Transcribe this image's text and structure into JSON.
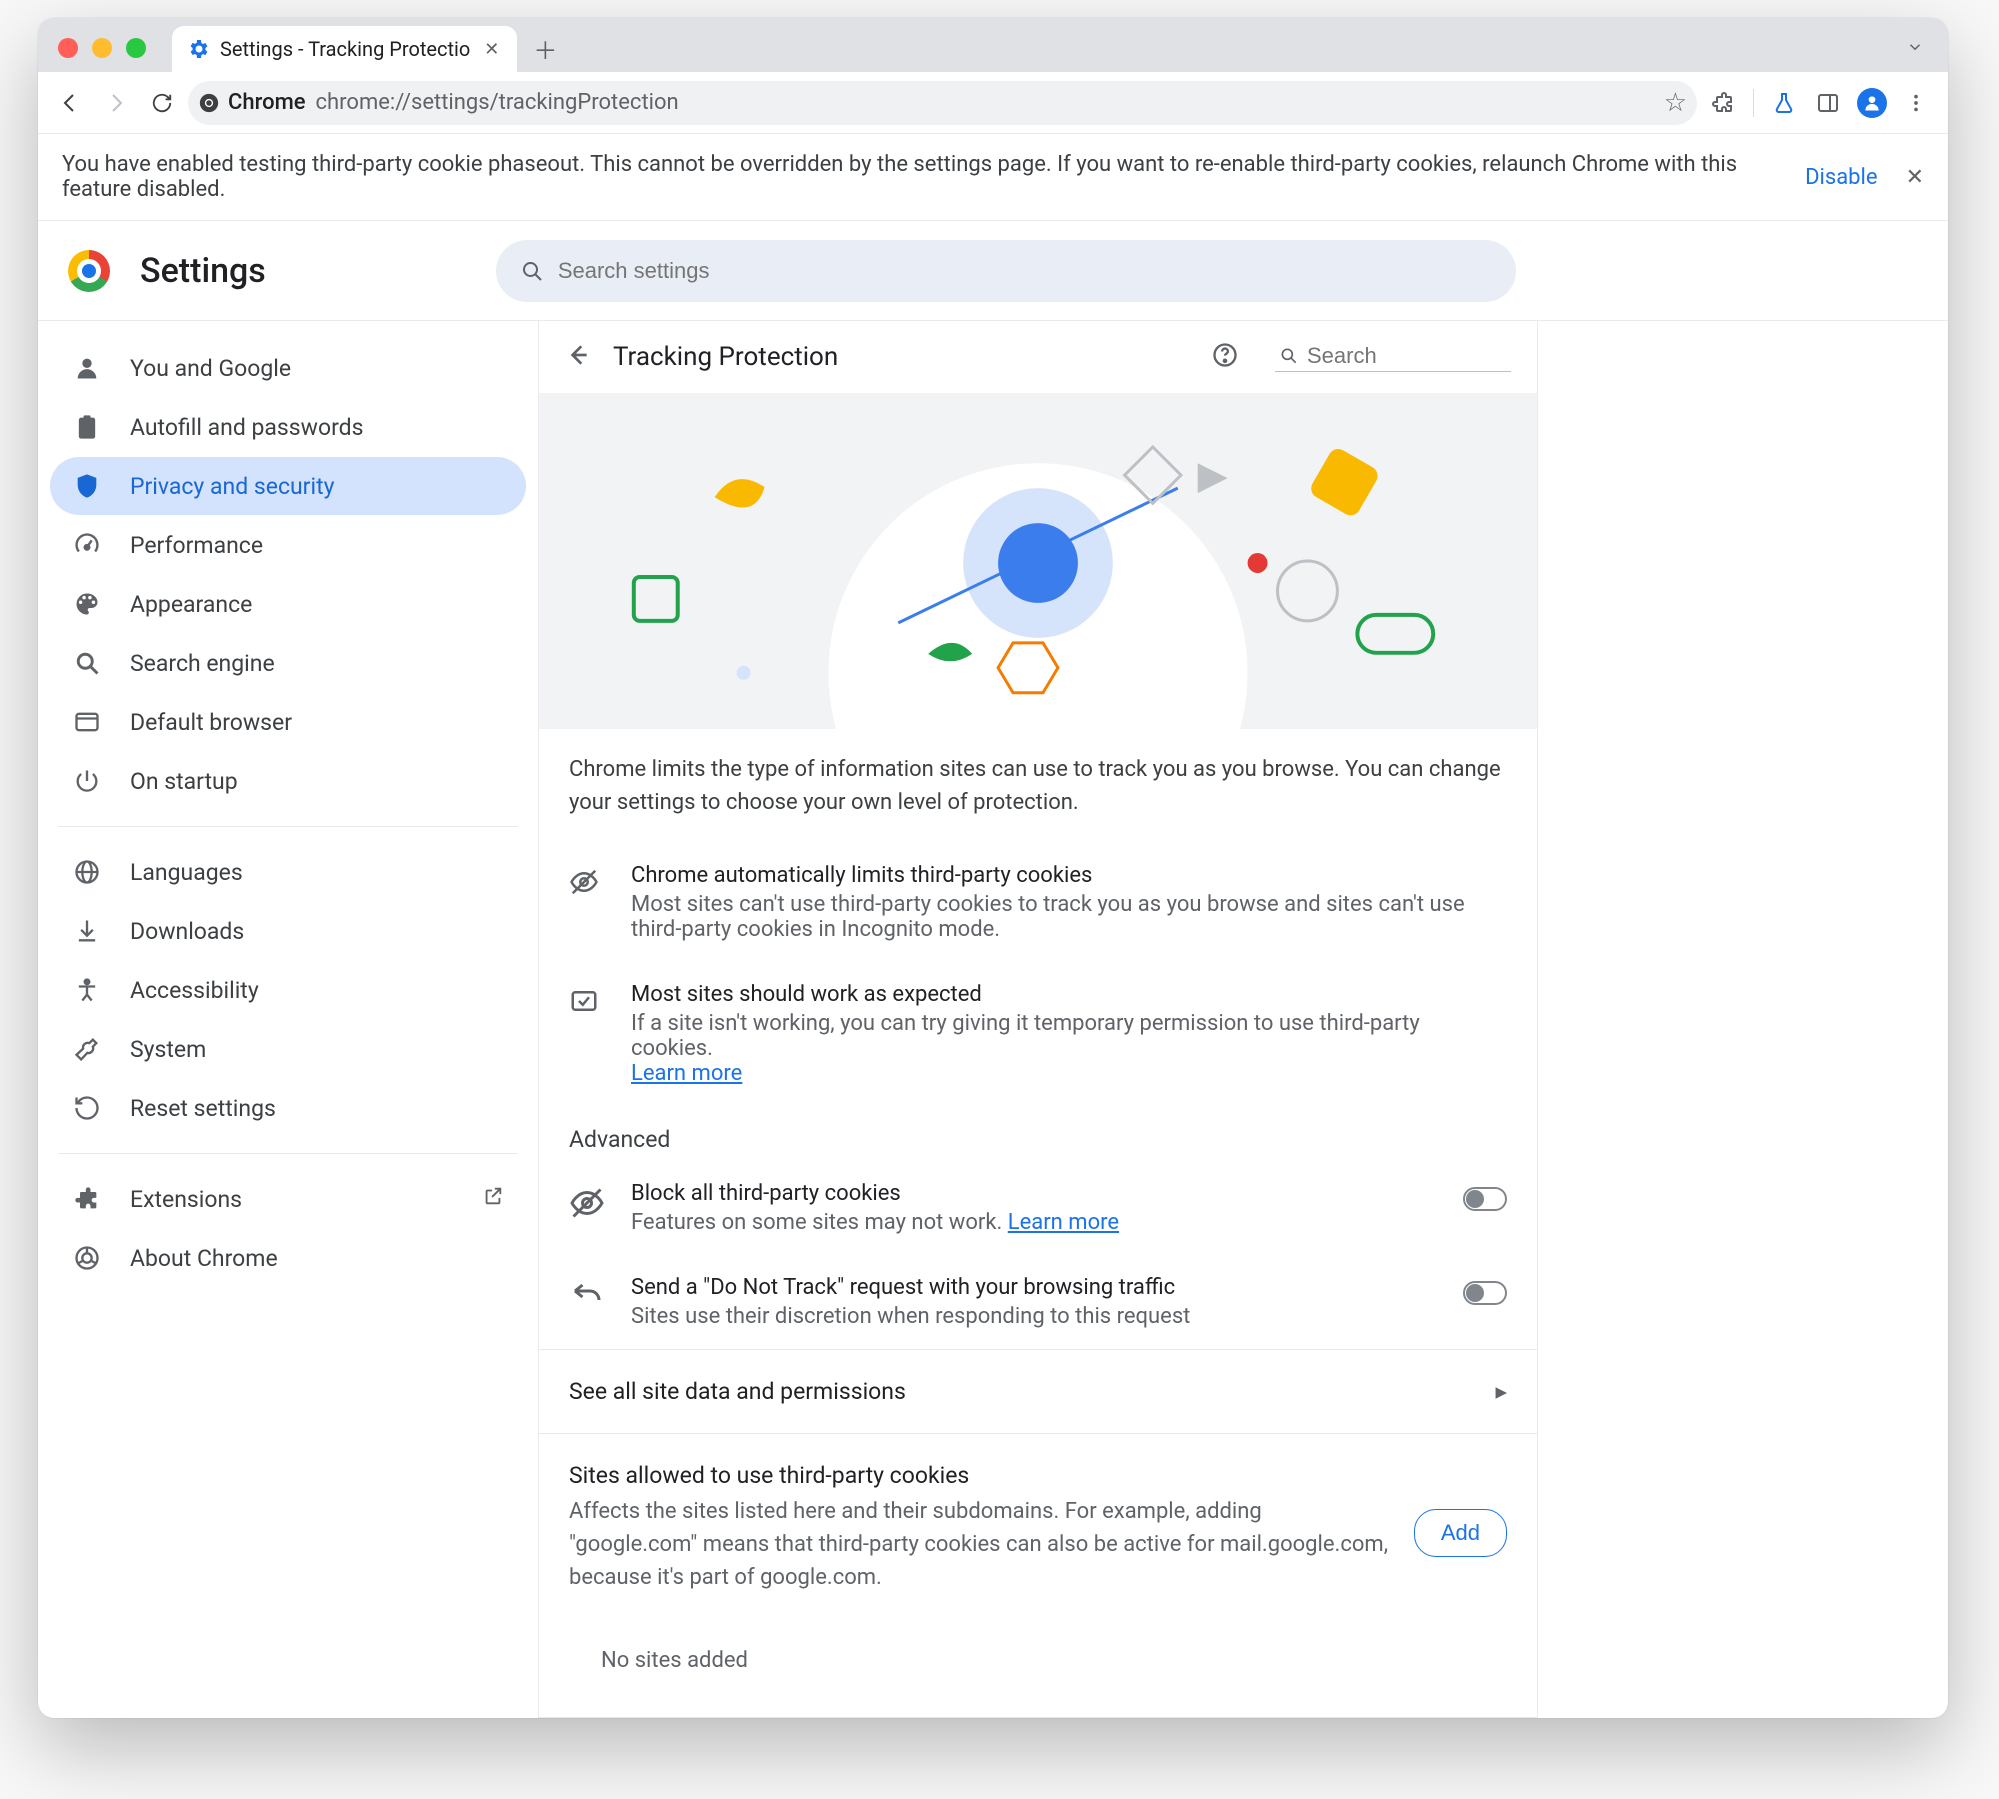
{
  "tab": {
    "title": "Settings - Tracking Protectio"
  },
  "toolbar": {
    "chrome_label": "Chrome",
    "url": "chrome://settings/trackingProtection"
  },
  "infobar": {
    "text": "You have enabled testing third-party cookie phaseout. This cannot be overridden by the settings page. If you want to re-enable third-party cookies, relaunch Chrome with this feature disabled.",
    "disable": "Disable"
  },
  "app": {
    "title": "Settings",
    "search_placeholder": "Search settings"
  },
  "sidebar": {
    "items": [
      "You and Google",
      "Autofill and passwords",
      "Privacy and security",
      "Performance",
      "Appearance",
      "Search engine",
      "Default browser",
      "On startup"
    ],
    "items2": [
      "Languages",
      "Downloads",
      "Accessibility",
      "System",
      "Reset settings"
    ],
    "items3": [
      "Extensions",
      "About Chrome"
    ]
  },
  "panel": {
    "title": "Tracking Protection",
    "search_placeholder": "Search",
    "intro": "Chrome limits the type of information sites can use to track you as you browse. You can change your settings to choose your own level of protection.",
    "bullets": [
      {
        "title": "Chrome automatically limits third-party cookies",
        "desc": "Most sites can't use third-party cookies to track you as you browse and sites can't use third-party cookies in Incognito mode."
      },
      {
        "title": "Most sites should work as expected",
        "desc": "If a site isn't working, you can try giving it temporary permission to use third-party cookies.",
        "link": "Learn more"
      }
    ],
    "advanced_label": "Advanced",
    "advanced": [
      {
        "title": "Block all third-party cookies",
        "desc": "Features on some sites may not work.",
        "link": "Learn more"
      },
      {
        "title": "Send a \"Do Not Track\" request with your browsing traffic",
        "desc": "Sites use their discretion when responding to this request"
      }
    ],
    "all_sites": "See all site data and permissions",
    "allow": {
      "title": "Sites allowed to use third-party cookies",
      "desc": "Affects the sites listed here and their subdomains. For example, adding \"google.com\" means that third-party cookies can also be active for mail.google.com, because it's part of google.com.",
      "add": "Add",
      "empty": "No sites added"
    }
  }
}
